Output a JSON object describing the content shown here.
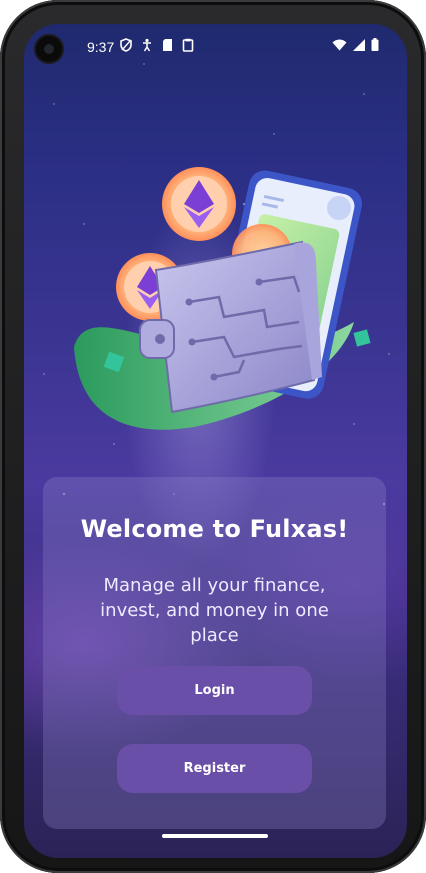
{
  "status_bar": {
    "time": "9:37"
  },
  "welcome": {
    "title": "Welcome to Fulxas!",
    "subtitle": "Manage all your finance, invest, and money in one place"
  },
  "actions": {
    "login_label": "Login",
    "register_label": "Register"
  },
  "colors": {
    "button": "#6a4fa8",
    "card": "#8c82c8",
    "background_top": "#1f2a6e",
    "background_mid": "#4b3aa0"
  },
  "icons": [
    "shield-icon",
    "accessibility-icon",
    "sd-card-icon",
    "clipboard-icon",
    "wifi-icon",
    "signal-icon",
    "battery-icon",
    "ethereum-coin-icon",
    "wallet-icon",
    "phone-icon"
  ]
}
